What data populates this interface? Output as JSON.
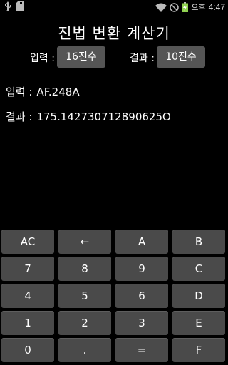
{
  "status_bar": {
    "icons": [
      "usb-icon",
      "sd-card-icon",
      "wifi-icon",
      "mute-icon",
      "battery-charging-icon"
    ],
    "ampm": "오후",
    "time": "4:47"
  },
  "title": "진법 변환 계산기",
  "mode": {
    "input_label": "입력 :",
    "input_base": "16진수",
    "output_label": "결과 :",
    "output_base": "10진수"
  },
  "input": {
    "label": "입력 :",
    "value": "AF.248A"
  },
  "result": {
    "label": "결과 :",
    "value": "175.142730712890625O"
  },
  "keypad": [
    [
      "AC",
      "←",
      "A",
      "B"
    ],
    [
      "7",
      "8",
      "9",
      "C"
    ],
    [
      "4",
      "5",
      "6",
      "D"
    ],
    [
      "1",
      "2",
      "3",
      "E"
    ],
    [
      "0",
      ".",
      "=",
      "F"
    ]
  ],
  "colors": {
    "background": "#000000",
    "key": "#4a4a4a",
    "mode_button": "#555555"
  }
}
